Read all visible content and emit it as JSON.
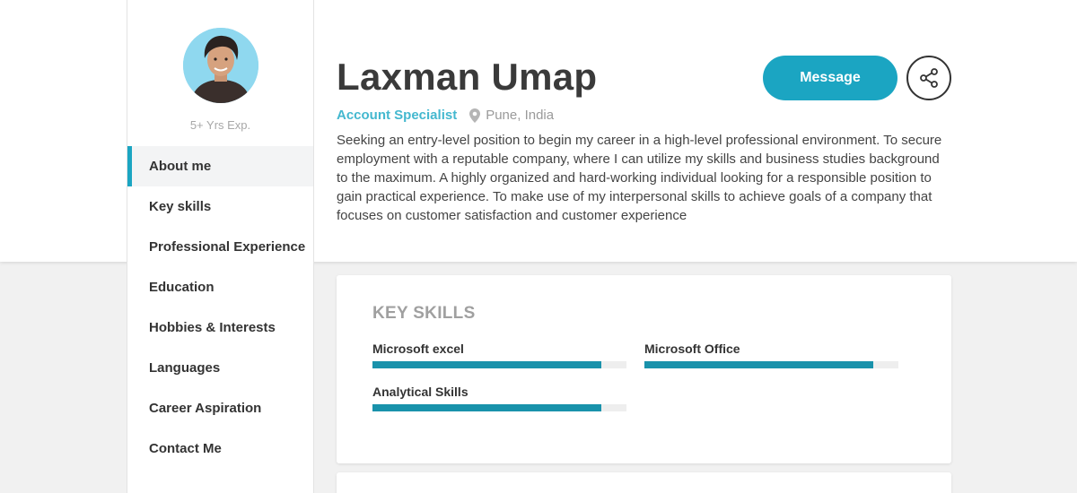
{
  "profile": {
    "name": "Laxman Umap",
    "role": "Account Specialist",
    "location": "Pune, India",
    "experience": "5+ Yrs Exp.",
    "bio": "Seeking an entry-level position to begin my career in a high-level professional environment. To secure employment with a reputable company, where I can utilize my skills and business studies background to the maximum. A highly organized and hard-working individual looking for a responsible position to gain practical experience. To make use of my interpersonal skills to achieve goals of a company that focuses on customer satisfaction and customer experience"
  },
  "actions": {
    "message_label": "Message",
    "share_icon": "share-icon"
  },
  "sidebar": {
    "items": [
      {
        "label": "About me",
        "active": true
      },
      {
        "label": "Key skills"
      },
      {
        "label": "Professional Experience"
      },
      {
        "label": "Education"
      },
      {
        "label": "Hobbies & Interests"
      },
      {
        "label": "Languages"
      },
      {
        "label": "Career Aspiration"
      },
      {
        "label": "Contact Me"
      }
    ]
  },
  "skills": {
    "title": "KEY SKILLS",
    "items": [
      {
        "name": "Microsoft excel",
        "level": 0.9
      },
      {
        "name": "Microsoft Office",
        "level": 0.9
      },
      {
        "name": "Analytical Skills",
        "level": 0.9
      }
    ]
  },
  "colors": {
    "accent": "#1ba5c2",
    "role_text": "#44b8cf",
    "skill_bar": "#1992ab"
  }
}
